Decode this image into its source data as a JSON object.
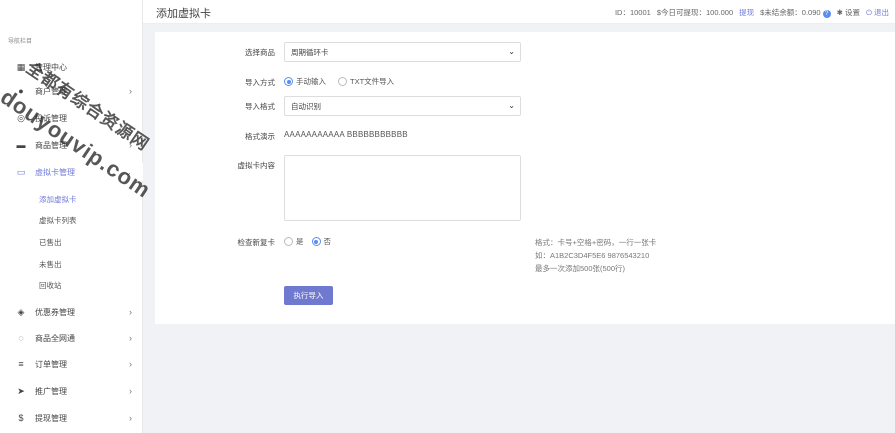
{
  "header": {
    "title": "添加虚拟卡",
    "id_label": "ID：10001",
    "withdraw_label": "$今日可提现：100.000",
    "withdraw_link": "提现",
    "unsettled_label": "$未结余额：0.090",
    "badge": "?",
    "settings": "设置",
    "logout": "退出"
  },
  "sidebar": {
    "brand": "导航栏目",
    "items": [
      {
        "label": "管理中心",
        "icon": "dashboard-icon"
      },
      {
        "label": "商户管理",
        "icon": "user-icon"
      },
      {
        "label": "投诉管理",
        "icon": "complaint-icon"
      },
      {
        "label": "商品管理",
        "icon": "goods-icon"
      },
      {
        "label": "虚拟卡管理",
        "icon": "card-icon"
      },
      {
        "label": "优惠券管理",
        "icon": "coupon-icon"
      },
      {
        "label": "商品全网通",
        "icon": "network-icon"
      },
      {
        "label": "订单管理",
        "icon": "list-icon"
      },
      {
        "label": "推广管理",
        "icon": "send-icon"
      },
      {
        "label": "提现管理",
        "icon": "dollar-icon"
      }
    ],
    "sub_items": [
      "添加虚拟卡",
      "虚拟卡列表",
      "已售出",
      "未售出",
      "回收站"
    ]
  },
  "form": {
    "goods_label": "选择商品",
    "goods_value": "周期循环卡",
    "import_mode_label": "导入方式",
    "import_mode_manual": "手动输入",
    "import_mode_txt": "TXT文件导入",
    "import_format_label": "导入格式",
    "import_format_value": "自动识别",
    "format_demo_label": "格式演示",
    "format_demo_value": "AAAAAAAAAAA BBBBBBBBBBB",
    "content_label": "虚拟卡内容",
    "dup_check_label": "检查新复卡",
    "dup_yes": "是",
    "dup_no": "否",
    "hint_line1": "格式：卡号+空格+密码，一行一张卡",
    "hint_line2": "如：A1B2C3D4F5E6 9876543210",
    "hint_line3": "最多一次添加500张(500行)",
    "submit": "执行导入"
  },
  "watermark": {
    "line1": "全都有综合资源网",
    "line2": "douyouvip.com"
  },
  "colors": {
    "accent": "#6f7ad8",
    "button": "#6f79cf",
    "radio": "#5b8def"
  }
}
